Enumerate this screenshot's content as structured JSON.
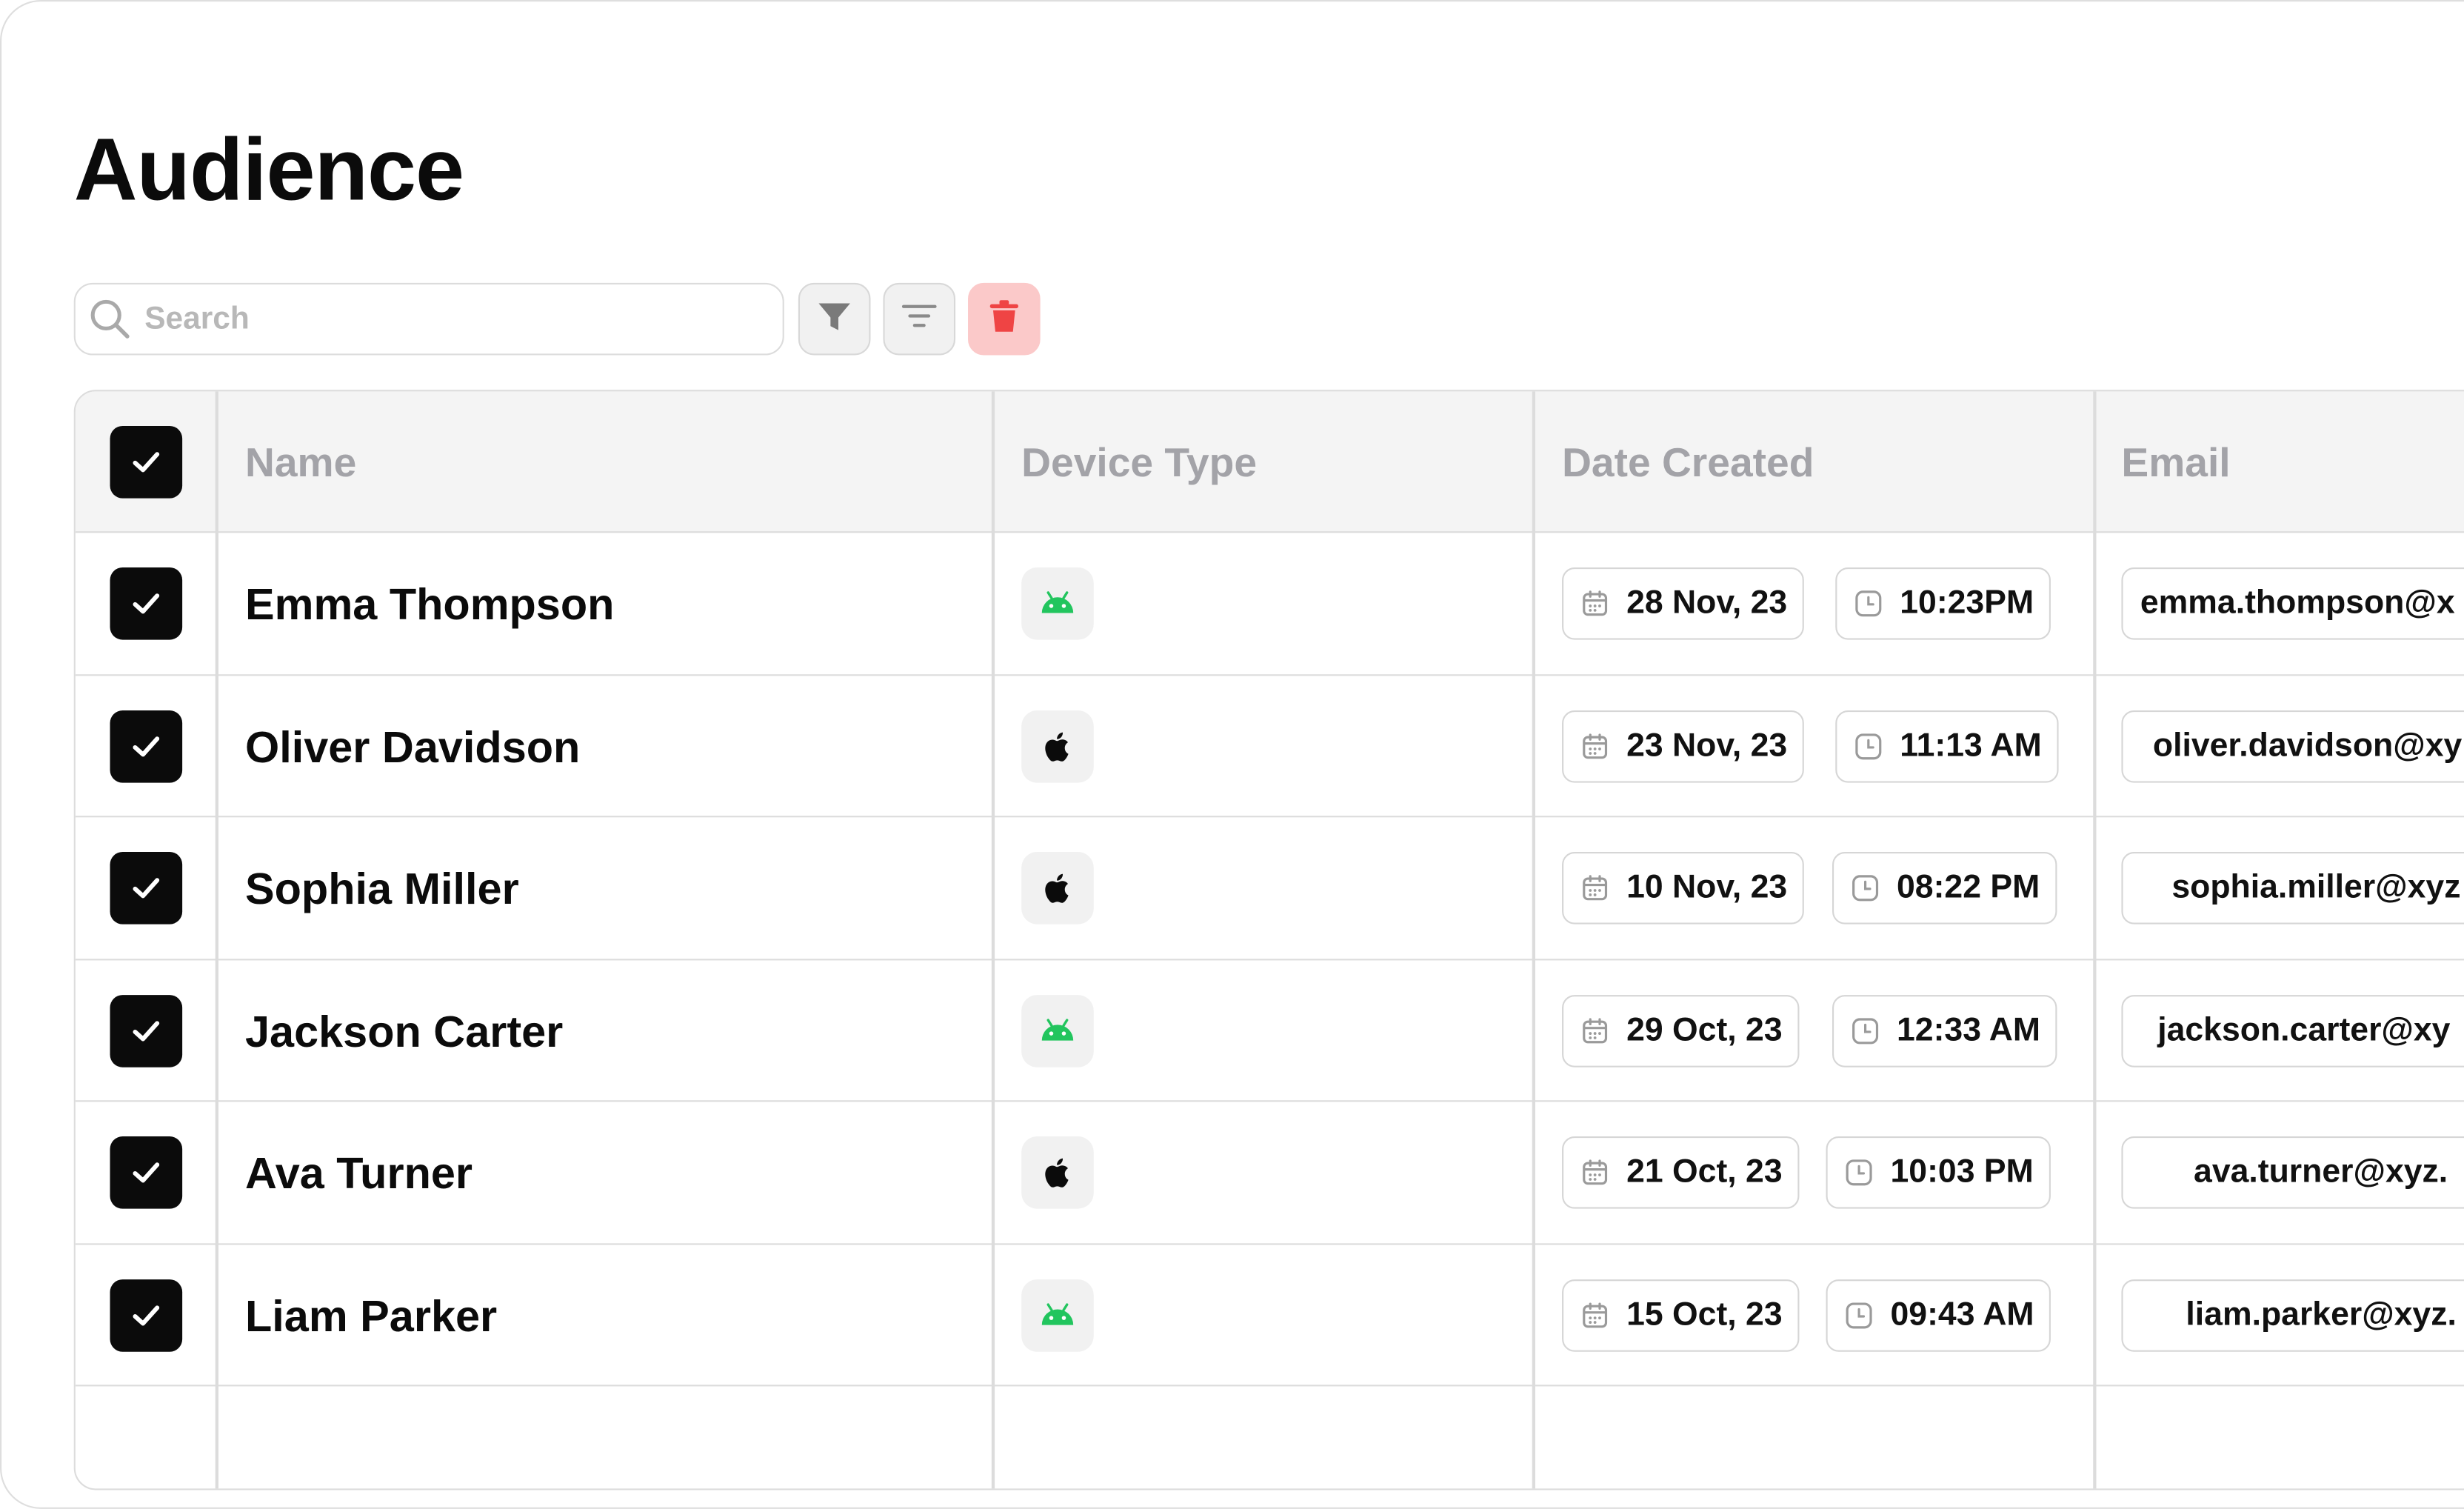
{
  "page": {
    "title": "Audience"
  },
  "toolbar": {
    "search_placeholder": "Search",
    "search_value": "",
    "filter_icon": "filter-icon",
    "sort_icon": "sort-lines-icon",
    "delete_icon": "trash-icon"
  },
  "table": {
    "columns": [
      "Name",
      "Device Type",
      "Date Created",
      "Email"
    ],
    "rows": [
      {
        "name": "Emma Thompson",
        "device": "android",
        "date": "28 Nov, 23",
        "time": "10:23PM",
        "email": "emma.thompson@x"
      },
      {
        "name": "Oliver Davidson",
        "device": "apple",
        "date": "23 Nov, 23",
        "time": "11:13 AM",
        "email": "oliver.davidson@xy"
      },
      {
        "name": "Sophia Miller",
        "device": "apple",
        "date": "10 Nov, 23",
        "time": "08:22 PM",
        "email": "sophia.miller@xyz"
      },
      {
        "name": "Jackson Carter",
        "device": "android",
        "date": "29 Oct, 23",
        "time": "12:33 AM",
        "email": "jackson.carter@xy"
      },
      {
        "name": "Ava Turner",
        "device": "apple",
        "date": "21 Oct, 23",
        "time": "10:03 PM",
        "email": "ava.turner@xyz."
      },
      {
        "name": "Liam Parker",
        "device": "android",
        "date": "15 Oct, 23",
        "time": "09:43 AM",
        "email": "liam.parker@xyz."
      }
    ]
  },
  "colors": {
    "android": "#22c55e",
    "delete_bg": "#fbc9c9",
    "delete_icon": "#ef4444",
    "checkbox": "#0b0b0b"
  }
}
